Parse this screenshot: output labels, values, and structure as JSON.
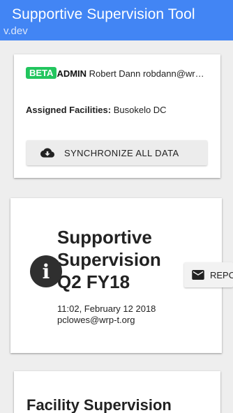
{
  "appbar": {
    "title": "Supportive Supervision Tool",
    "version": "v.dev"
  },
  "user_card": {
    "badge": "BETA",
    "role": "ADMIN",
    "user_text": " Robert Dann robdann@wrp-t.org",
    "facilities_label": "Assigned Facilities:",
    "facilities_value": " Busokelo DC",
    "sync_label": "SYNCHRONIZE ALL DATA",
    "sync_icon": "cloud-download-icon"
  },
  "supervision_card": {
    "title": "Supportive Supervision Q2 FY18",
    "meta": "11:02, February 12 2018 pclowes@wrp-t.org",
    "info_icon": "info-icon",
    "email_label": "REPORT",
    "email_icon": "email-icon"
  },
  "facility_card": {
    "title": "Facility Supervision"
  },
  "colors": {
    "primary": "#4285f4",
    "beta_badge": "#22c55e",
    "background": "#eeeeee"
  }
}
